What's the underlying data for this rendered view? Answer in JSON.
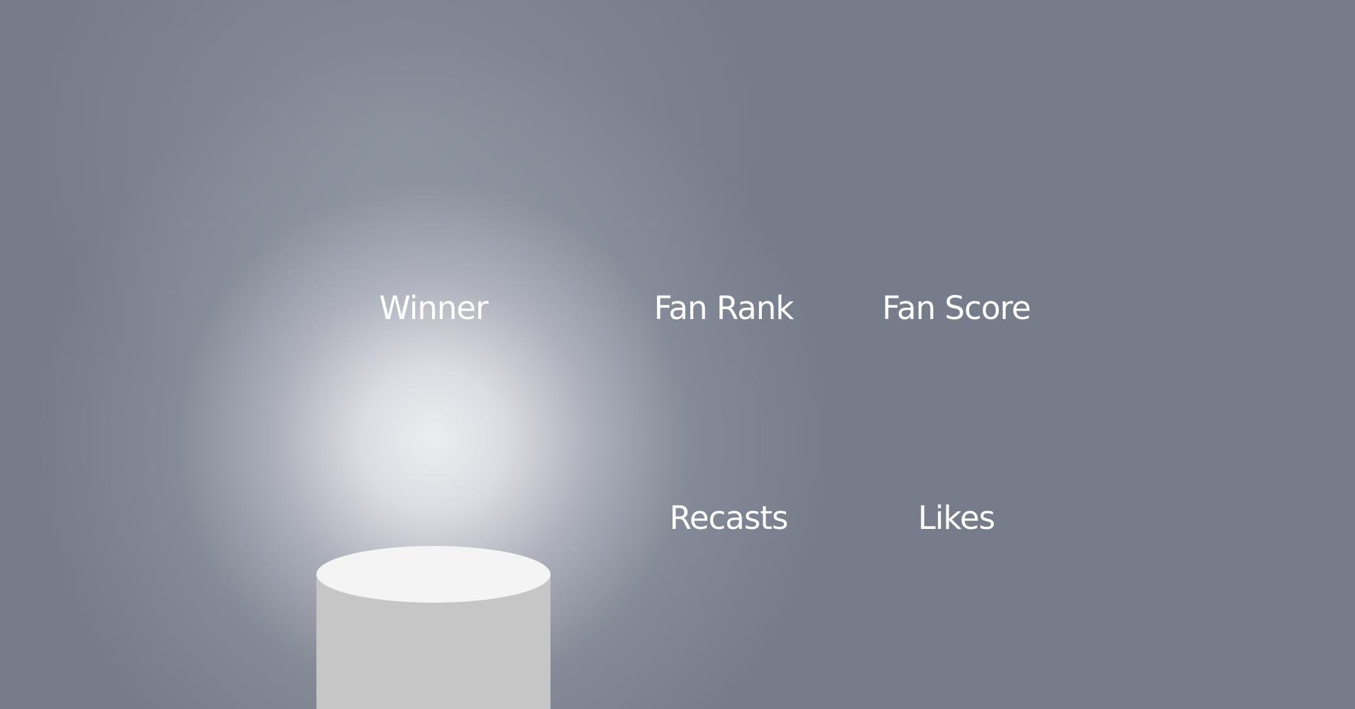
{
  "labels": {
    "winner": "Winner",
    "fan_rank": "Fan Rank",
    "fan_score": "Fan Score",
    "recasts": "Recasts",
    "likes": "Likes"
  },
  "colors": {
    "background": "#767c8a",
    "spotlight": "#ecedf1",
    "podium_top": "#f4f4f4",
    "podium_body": "#c6c6c6",
    "text": "#ffffff"
  }
}
